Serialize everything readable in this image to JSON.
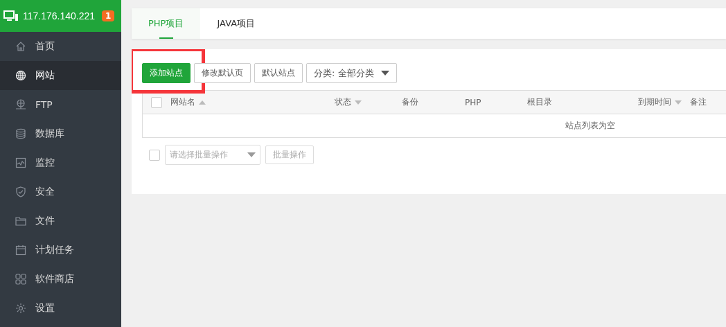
{
  "header": {
    "host": "117.176.140.221",
    "badge": "1"
  },
  "sidebar": {
    "items": [
      {
        "label": "首页",
        "selected": false
      },
      {
        "label": "网站",
        "selected": true
      },
      {
        "label": "FTP",
        "selected": false
      },
      {
        "label": "数据库",
        "selected": false
      },
      {
        "label": "监控",
        "selected": false
      },
      {
        "label": "安全",
        "selected": false
      },
      {
        "label": "文件",
        "selected": false
      },
      {
        "label": "计划任务",
        "selected": false
      },
      {
        "label": "软件商店",
        "selected": false
      },
      {
        "label": "设置",
        "selected": false
      }
    ]
  },
  "tabs": [
    {
      "label": "PHP项目",
      "selected": true
    },
    {
      "label": "JAVA项目",
      "selected": false
    }
  ],
  "toolbar": {
    "buttons": [
      {
        "label": "添加站点",
        "kind": "primary",
        "highlighted": true
      },
      {
        "label": "修改默认页",
        "kind": "default",
        "highlighted": false
      },
      {
        "label": "默认站点",
        "kind": "default",
        "highlighted": false
      }
    ],
    "category": "分类: 全部分类"
  },
  "table": {
    "columns": [
      {
        "label": "网站名",
        "kind": "ascending"
      },
      {
        "label": "状态",
        "kind": "descending"
      },
      {
        "label": "备份",
        "kind": "plain"
      },
      {
        "label": "PHP",
        "kind": "plain"
      },
      {
        "label": "根目录",
        "kind": "plain"
      },
      {
        "label": "到期时间",
        "kind": "descending"
      },
      {
        "label": "备注",
        "kind": "plain"
      }
    ],
    "select_all_checked": false,
    "empty_text": "站点列表为空"
  },
  "batch": {
    "checked": false,
    "placeholder": "请选择批量操作",
    "button": "批量操作"
  }
}
